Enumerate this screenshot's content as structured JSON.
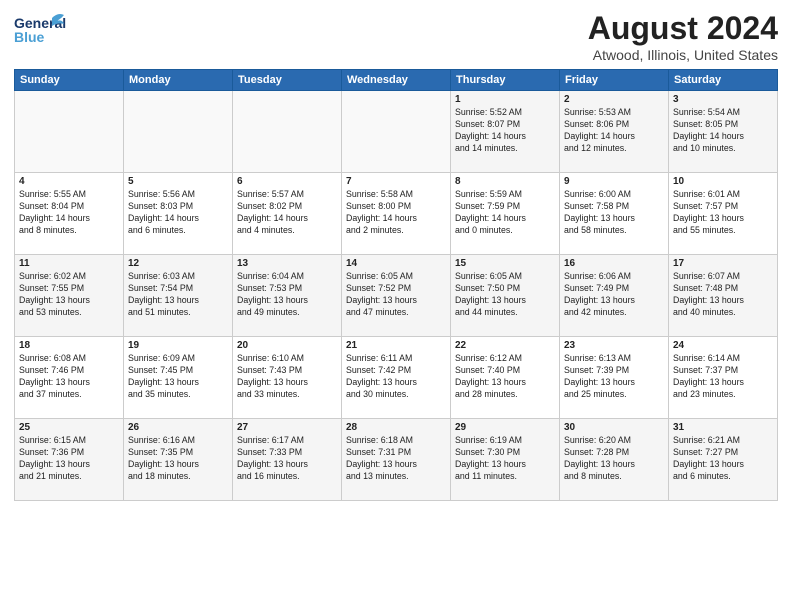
{
  "header": {
    "logo_general": "General",
    "logo_blue": "Blue",
    "main_title": "August 2024",
    "subtitle": "Atwood, Illinois, United States"
  },
  "weekdays": [
    "Sunday",
    "Monday",
    "Tuesday",
    "Wednesday",
    "Thursday",
    "Friday",
    "Saturday"
  ],
  "weeks": [
    [
      {
        "day": "",
        "info": ""
      },
      {
        "day": "",
        "info": ""
      },
      {
        "day": "",
        "info": ""
      },
      {
        "day": "",
        "info": ""
      },
      {
        "day": "1",
        "info": "Sunrise: 5:52 AM\nSunset: 8:07 PM\nDaylight: 14 hours\nand 14 minutes."
      },
      {
        "day": "2",
        "info": "Sunrise: 5:53 AM\nSunset: 8:06 PM\nDaylight: 14 hours\nand 12 minutes."
      },
      {
        "day": "3",
        "info": "Sunrise: 5:54 AM\nSunset: 8:05 PM\nDaylight: 14 hours\nand 10 minutes."
      }
    ],
    [
      {
        "day": "4",
        "info": "Sunrise: 5:55 AM\nSunset: 8:04 PM\nDaylight: 14 hours\nand 8 minutes."
      },
      {
        "day": "5",
        "info": "Sunrise: 5:56 AM\nSunset: 8:03 PM\nDaylight: 14 hours\nand 6 minutes."
      },
      {
        "day": "6",
        "info": "Sunrise: 5:57 AM\nSunset: 8:02 PM\nDaylight: 14 hours\nand 4 minutes."
      },
      {
        "day": "7",
        "info": "Sunrise: 5:58 AM\nSunset: 8:00 PM\nDaylight: 14 hours\nand 2 minutes."
      },
      {
        "day": "8",
        "info": "Sunrise: 5:59 AM\nSunset: 7:59 PM\nDaylight: 14 hours\nand 0 minutes."
      },
      {
        "day": "9",
        "info": "Sunrise: 6:00 AM\nSunset: 7:58 PM\nDaylight: 13 hours\nand 58 minutes."
      },
      {
        "day": "10",
        "info": "Sunrise: 6:01 AM\nSunset: 7:57 PM\nDaylight: 13 hours\nand 55 minutes."
      }
    ],
    [
      {
        "day": "11",
        "info": "Sunrise: 6:02 AM\nSunset: 7:55 PM\nDaylight: 13 hours\nand 53 minutes."
      },
      {
        "day": "12",
        "info": "Sunrise: 6:03 AM\nSunset: 7:54 PM\nDaylight: 13 hours\nand 51 minutes."
      },
      {
        "day": "13",
        "info": "Sunrise: 6:04 AM\nSunset: 7:53 PM\nDaylight: 13 hours\nand 49 minutes."
      },
      {
        "day": "14",
        "info": "Sunrise: 6:05 AM\nSunset: 7:52 PM\nDaylight: 13 hours\nand 47 minutes."
      },
      {
        "day": "15",
        "info": "Sunrise: 6:05 AM\nSunset: 7:50 PM\nDaylight: 13 hours\nand 44 minutes."
      },
      {
        "day": "16",
        "info": "Sunrise: 6:06 AM\nSunset: 7:49 PM\nDaylight: 13 hours\nand 42 minutes."
      },
      {
        "day": "17",
        "info": "Sunrise: 6:07 AM\nSunset: 7:48 PM\nDaylight: 13 hours\nand 40 minutes."
      }
    ],
    [
      {
        "day": "18",
        "info": "Sunrise: 6:08 AM\nSunset: 7:46 PM\nDaylight: 13 hours\nand 37 minutes."
      },
      {
        "day": "19",
        "info": "Sunrise: 6:09 AM\nSunset: 7:45 PM\nDaylight: 13 hours\nand 35 minutes."
      },
      {
        "day": "20",
        "info": "Sunrise: 6:10 AM\nSunset: 7:43 PM\nDaylight: 13 hours\nand 33 minutes."
      },
      {
        "day": "21",
        "info": "Sunrise: 6:11 AM\nSunset: 7:42 PM\nDaylight: 13 hours\nand 30 minutes."
      },
      {
        "day": "22",
        "info": "Sunrise: 6:12 AM\nSunset: 7:40 PM\nDaylight: 13 hours\nand 28 minutes."
      },
      {
        "day": "23",
        "info": "Sunrise: 6:13 AM\nSunset: 7:39 PM\nDaylight: 13 hours\nand 25 minutes."
      },
      {
        "day": "24",
        "info": "Sunrise: 6:14 AM\nSunset: 7:37 PM\nDaylight: 13 hours\nand 23 minutes."
      }
    ],
    [
      {
        "day": "25",
        "info": "Sunrise: 6:15 AM\nSunset: 7:36 PM\nDaylight: 13 hours\nand 21 minutes."
      },
      {
        "day": "26",
        "info": "Sunrise: 6:16 AM\nSunset: 7:35 PM\nDaylight: 13 hours\nand 18 minutes."
      },
      {
        "day": "27",
        "info": "Sunrise: 6:17 AM\nSunset: 7:33 PM\nDaylight: 13 hours\nand 16 minutes."
      },
      {
        "day": "28",
        "info": "Sunrise: 6:18 AM\nSunset: 7:31 PM\nDaylight: 13 hours\nand 13 minutes."
      },
      {
        "day": "29",
        "info": "Sunrise: 6:19 AM\nSunset: 7:30 PM\nDaylight: 13 hours\nand 11 minutes."
      },
      {
        "day": "30",
        "info": "Sunrise: 6:20 AM\nSunset: 7:28 PM\nDaylight: 13 hours\nand 8 minutes."
      },
      {
        "day": "31",
        "info": "Sunrise: 6:21 AM\nSunset: 7:27 PM\nDaylight: 13 hours\nand 6 minutes."
      }
    ]
  ]
}
